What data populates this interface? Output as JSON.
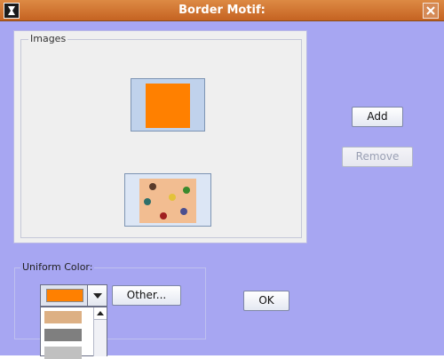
{
  "window": {
    "title": "Border Motif:",
    "icons": {
      "app": "app-icon",
      "close": "close-icon"
    }
  },
  "images_panel": {
    "legend": "Images",
    "items": [
      {
        "name": "orange-swatch-image",
        "color": "#ff8000"
      },
      {
        "name": "bugs-pattern-image",
        "background": "#f2bd91"
      }
    ]
  },
  "actions": {
    "add_label": "Add",
    "remove_label": "Remove",
    "ok_label": "OK"
  },
  "uniform_color": {
    "legend": "Uniform Color:",
    "selected_color": "#ff8000",
    "other_label": "Other...",
    "options": [
      {
        "color": "#ddb084"
      },
      {
        "color": "#7f7f7f"
      },
      {
        "color": "#c0c0c0"
      }
    ]
  },
  "colors": {
    "background": "#a7a6f2",
    "titlebar": "#c56322",
    "panel": "#efefef",
    "accent_orange": "#ff8000"
  }
}
